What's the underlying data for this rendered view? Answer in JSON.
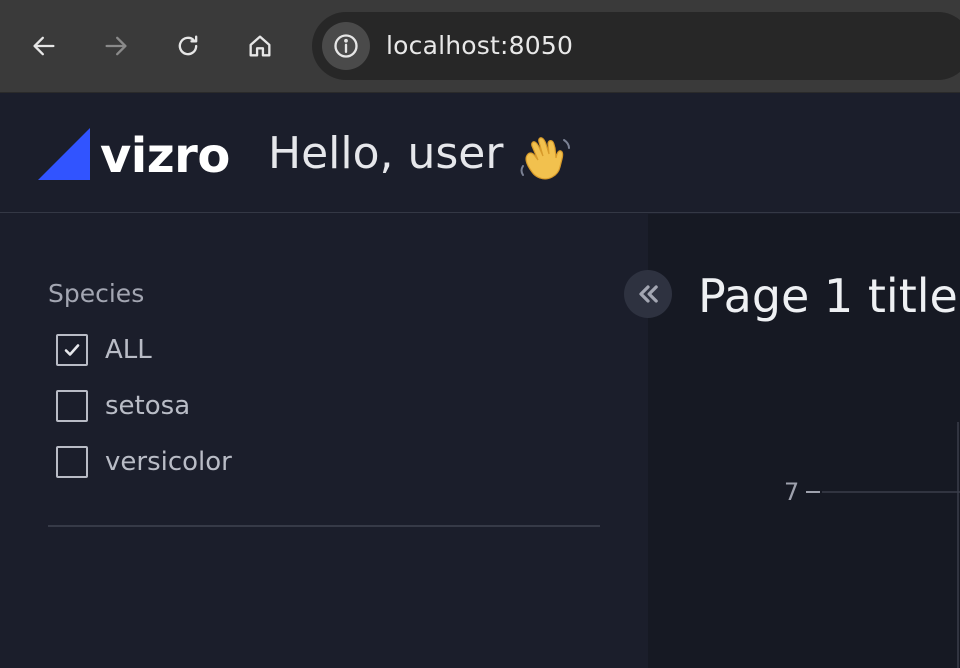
{
  "browser": {
    "url": "localhost:8050",
    "back_icon": "back-arrow-icon",
    "forward_icon": "forward-arrow-icon",
    "reload_icon": "reload-icon",
    "home_icon": "home-icon",
    "info_icon": "info-icon"
  },
  "header": {
    "logo_text": "vizro",
    "title": "Hello, user",
    "title_icon": "waving-hand-icon",
    "accent_color": "#3154ff"
  },
  "sidebar": {
    "filter_label": "Species",
    "options": [
      {
        "label": "ALL",
        "checked": true
      },
      {
        "label": "setosa",
        "checked": false
      },
      {
        "label": "versicolor",
        "checked": false
      }
    ],
    "collapse_icon": "double-chevron-left-icon"
  },
  "main": {
    "page_title": "Page 1 title"
  },
  "chart_data": {
    "type": "scatter",
    "yticks": [
      7
    ],
    "title": "",
    "xlabel": "",
    "ylabel": ""
  }
}
